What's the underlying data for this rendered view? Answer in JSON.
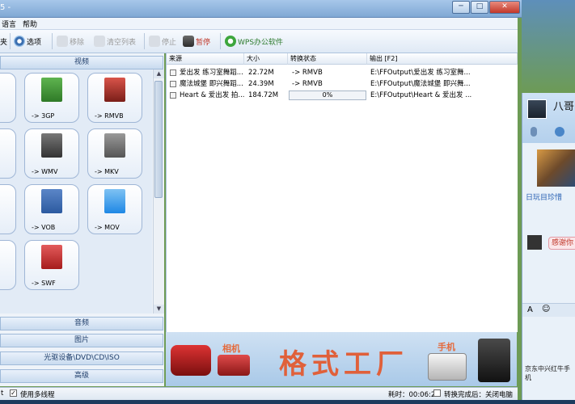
{
  "window": {
    "title_fragment": "5 -",
    "buttons": [
      "─",
      "□",
      "✕"
    ]
  },
  "menu": [
    "语言",
    "帮助"
  ],
  "toolbar": {
    "items": [
      {
        "label": "夹",
        "icon": "folder-icon",
        "enabled": true
      },
      {
        "label": "选项",
        "icon": "gear-icon",
        "enabled": true
      },
      {
        "label": "移除",
        "icon": "remove-icon",
        "enabled": false
      },
      {
        "label": "清空列表",
        "icon": "clear-list-icon",
        "enabled": false
      },
      {
        "label": "停止",
        "icon": "stop-icon",
        "enabled": false
      },
      {
        "label": "暂停",
        "icon": "pause-icon",
        "enabled": true
      },
      {
        "label": "WPS办公软件",
        "icon": "wps-icon",
        "enabled": true
      }
    ]
  },
  "categories": {
    "video": "视频",
    "audio": "音频",
    "picture": "图片",
    "disc": "光驱设备\\DVD\\CD\\ISO",
    "advanced": "高级"
  },
  "formats": [
    {
      "label": "-> 3GP",
      "badge": "3GP",
      "color": "#3a8f2e"
    },
    {
      "label": "-> RMVB",
      "badge": "RMVB",
      "color": "#c0392b"
    },
    {
      "label": "-> WMV",
      "badge": "WMV",
      "color": "#444444"
    },
    {
      "label": "-> MKV",
      "badge": "MKV",
      "color": "#6b6b6b"
    },
    {
      "label": "-> VOB",
      "badge": "VOB",
      "color": "#2c5aa0"
    },
    {
      "label": "-> MOV",
      "badge": "MOV",
      "color": "#1e88e5"
    },
    {
      "label": "-> SWF",
      "badge": "SWF",
      "color": "#c62828"
    }
  ],
  "list": {
    "columns": [
      "来源",
      "大小",
      "转换状态",
      "输出 [F2]"
    ],
    "rows": [
      {
        "source": "爱出发 练习室舞蹈...",
        "size": "22.72M",
        "status": "-> RMVB",
        "output": "E:\\FFOutput\\爱出发 练习室舞..."
      },
      {
        "source": "魔法城堡 即兴舞蹈...",
        "size": "24.39M",
        "status": "-> RMVB",
        "output": "E:\\FFOutput\\魔法城堡 即兴舞..."
      },
      {
        "source": "Heart & 爱出发 拍...",
        "size": "184.72M",
        "status": "0%",
        "output": "E:\\FFOutput\\Heart & 爱出发 ..."
      }
    ],
    "progress_fraction": 0
  },
  "banner": {
    "camera": "相机",
    "brand": "格式工厂",
    "phone": "手机"
  },
  "status": {
    "multithread": "使用多线程",
    "elapsed": "耗时：00:06:25",
    "after": "转换完成后：关闭电脑",
    "left_char": "t"
  },
  "qq": {
    "name": "八哥",
    "link": "日玩目珍惜",
    "bubble": "感谢你",
    "footer": "京东中兴红牛手机"
  }
}
